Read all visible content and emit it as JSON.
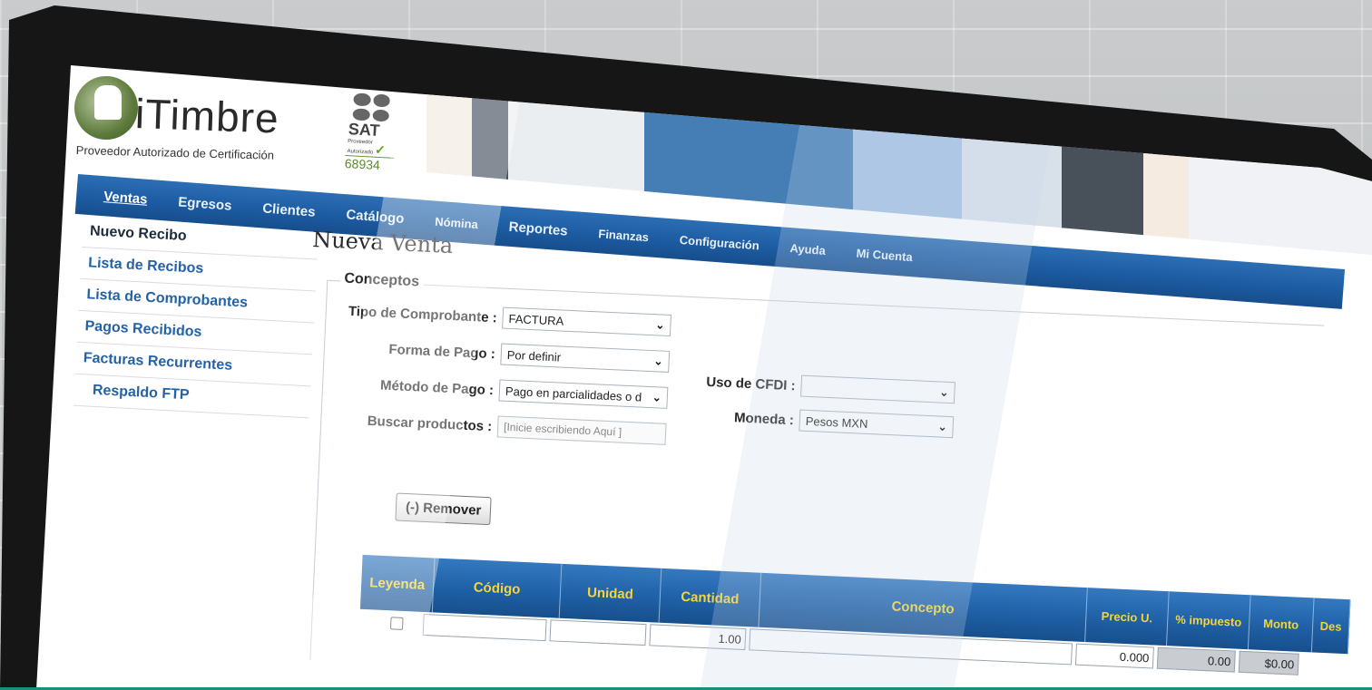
{
  "brand": {
    "name": "iTimbre",
    "subtitle": "Proveedor Autorizado de Certificación",
    "sat_label": "SAT",
    "sat_small": "Proveedor Autorizado",
    "sat_number": "68934"
  },
  "topnav": {
    "tabs": [
      {
        "label": "Ventas",
        "active": true
      },
      {
        "label": "Egresos"
      },
      {
        "label": "Clientes"
      },
      {
        "label": "Catálogo"
      },
      {
        "label": "Nómina"
      },
      {
        "label": "Reportes"
      },
      {
        "label": "Finanzas"
      },
      {
        "label": "Configuración"
      },
      {
        "label": "Ayuda"
      },
      {
        "label": "Mi Cuenta"
      }
    ]
  },
  "sidebar": {
    "items": [
      {
        "label": "Nuevo Recibo"
      },
      {
        "label": "Lista de Recibos"
      },
      {
        "label": "Lista de Comprobantes"
      },
      {
        "label": "Pagos Recibidos"
      },
      {
        "label": "Facturas Recurrentes"
      },
      {
        "label": "Respaldo FTP"
      }
    ]
  },
  "main": {
    "title": "Nueva Venta",
    "section": "Conceptos",
    "fields": {
      "tipo_label": "Tipo de Comprobante :",
      "tipo_value": "FACTURA",
      "forma_label": "Forma de Pago :",
      "forma_value": "Por definir",
      "metodo_label": "Método de Pago :",
      "metodo_value": "Pago en parcialidades o d",
      "buscar_label": "Buscar productos :",
      "buscar_placeholder": "[Inicie escribiendo Aquí ]",
      "uso_label": "Uso de CFDI :",
      "uso_value": "",
      "moneda_label": "Moneda :",
      "moneda_value": "Pesos MXN"
    },
    "remove_button": "(-) Remover",
    "table": {
      "headers": [
        "Leyenda",
        "Código",
        "Unidad",
        "Cantidad",
        "Concepto",
        "Precio U.",
        "% impuesto",
        "Monto",
        "Des"
      ],
      "row": {
        "cantidad": "1.00",
        "precio": "0.000",
        "impuesto": "0.00",
        "monto": "$0.00"
      }
    }
  },
  "colors": {
    "nav_blue": "#1c5aa0",
    "header_yellow": "#f4d53a",
    "link_blue": "#2462a6"
  }
}
